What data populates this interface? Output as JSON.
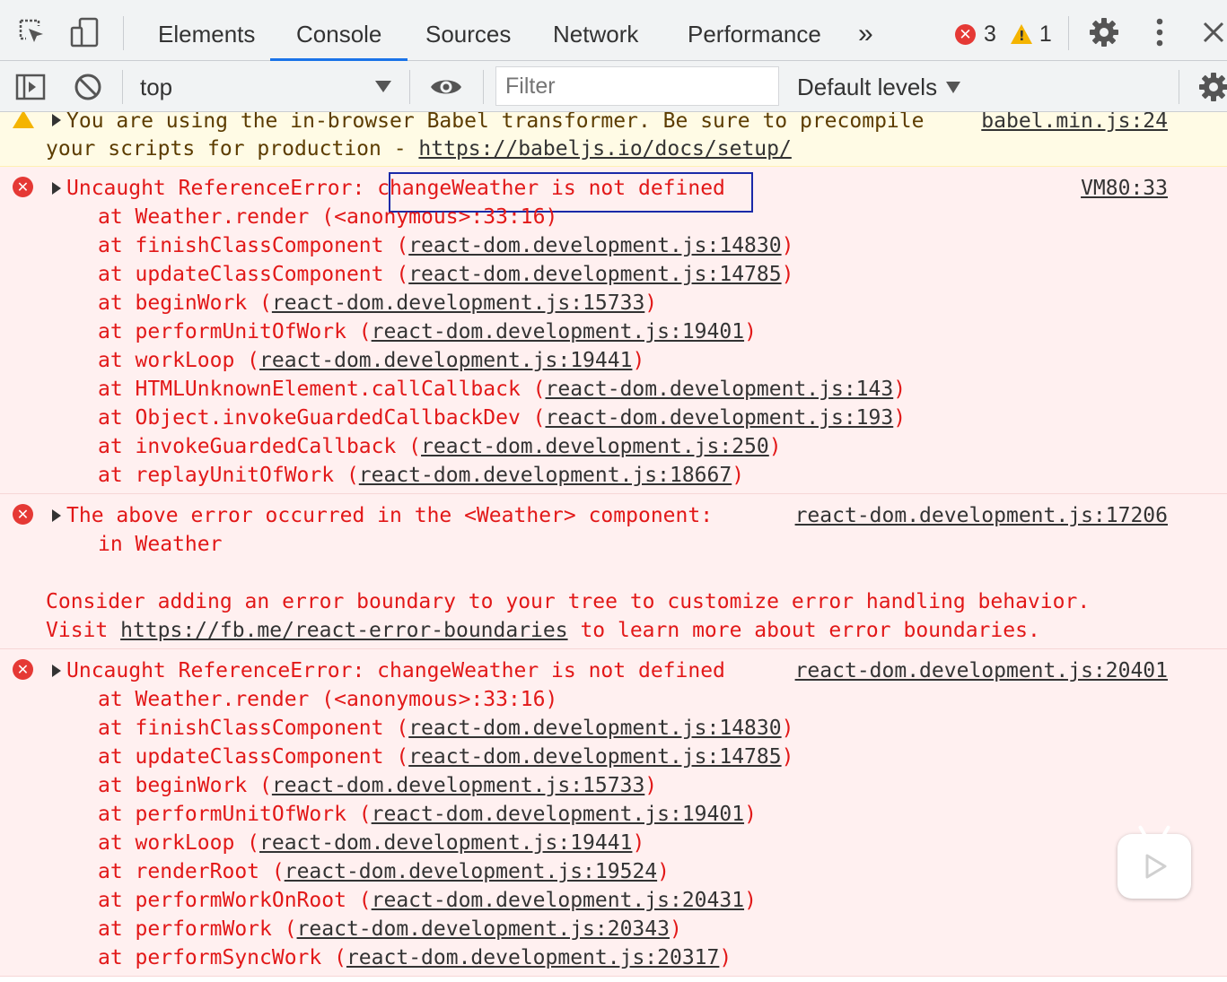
{
  "tabs": [
    {
      "label": "Elements",
      "active": false
    },
    {
      "label": "Console",
      "active": true
    },
    {
      "label": "Sources",
      "active": false
    },
    {
      "label": "Network",
      "active": false
    },
    {
      "label": "Performance",
      "active": false
    }
  ],
  "more_tabs_glyph": "»",
  "counts": {
    "errors": "3",
    "warnings": "1"
  },
  "toolbar": {
    "context": "top",
    "filter_placeholder": "Filter",
    "levels": "Default levels"
  },
  "icons": {
    "inspect": "inspect-element-icon",
    "device": "device-toolbar-icon",
    "settings": "gear-icon",
    "menu": "kebab-menu-icon",
    "close": "close-icon",
    "sidebar": "sidebar-toggle-icon",
    "clear": "clear-console-icon",
    "eye": "live-expression-icon"
  },
  "colors": {
    "accent": "#1a73e8",
    "error_text": "#e21818",
    "error_bg": "#fff0f0",
    "warn_bg": "#fffbe5"
  },
  "messages": {
    "warn": {
      "line1": "You are using the in-browser Babel transformer. Be sure to precompile",
      "line2_prefix": "your scripts for production - ",
      "line2_link": "https://babeljs.io/docs/setup/",
      "source": "babel.min.js:24"
    },
    "error1": {
      "prefix": "Uncaught ReferenceError: ",
      "highlighted": "changeWeather is not defined",
      "source": "VM80:33",
      "stack": [
        {
          "text": "at Weather.render (<anonymous>:33:16)",
          "link": ""
        },
        {
          "text": "at finishClassComponent (",
          "link": "react-dom.development.js:14830",
          "suffix": ")"
        },
        {
          "text": "at updateClassComponent (",
          "link": "react-dom.development.js:14785",
          "suffix": ")"
        },
        {
          "text": "at beginWork (",
          "link": "react-dom.development.js:15733",
          "suffix": ")"
        },
        {
          "text": "at performUnitOfWork (",
          "link": "react-dom.development.js:19401",
          "suffix": ")"
        },
        {
          "text": "at workLoop (",
          "link": "react-dom.development.js:19441",
          "suffix": ")"
        },
        {
          "text": "at HTMLUnknownElement.callCallback (",
          "link": "react-dom.development.js:143",
          "suffix": ")"
        },
        {
          "text": "at Object.invokeGuardedCallbackDev (",
          "link": "react-dom.development.js:193",
          "suffix": ")"
        },
        {
          "text": "at invokeGuardedCallback (",
          "link": "react-dom.development.js:250",
          "suffix": ")"
        },
        {
          "text": "at replayUnitOfWork (",
          "link": "react-dom.development.js:18667",
          "suffix": ")"
        }
      ]
    },
    "error2": {
      "line1": "The above error occurred in the <Weather> component:",
      "source": "react-dom.development.js:17206",
      "line2": "in Weather",
      "line3": "Consider adding an error boundary to your tree to customize error handling behavior.",
      "line4_prefix": "Visit ",
      "line4_link": "https://fb.me/react-error-boundaries",
      "line4_suffix": " to learn more about error boundaries."
    },
    "error3": {
      "line1": "Uncaught ReferenceError: changeWeather is not defined",
      "source": "react-dom.development.js:20401",
      "stack": [
        {
          "text": "at Weather.render (<anonymous>:33:16)",
          "link": ""
        },
        {
          "text": "at finishClassComponent (",
          "link": "react-dom.development.js:14830",
          "suffix": ")"
        },
        {
          "text": "at updateClassComponent (",
          "link": "react-dom.development.js:14785",
          "suffix": ")"
        },
        {
          "text": "at beginWork (",
          "link": "react-dom.development.js:15733",
          "suffix": ")"
        },
        {
          "text": "at performUnitOfWork (",
          "link": "react-dom.development.js:19401",
          "suffix": ")"
        },
        {
          "text": "at workLoop (",
          "link": "react-dom.development.js:19441",
          "suffix": ")"
        },
        {
          "text": "at renderRoot (",
          "link": "react-dom.development.js:19524",
          "suffix": ")"
        },
        {
          "text": "at performWorkOnRoot (",
          "link": "react-dom.development.js:20431",
          "suffix": ")"
        },
        {
          "text": "at performWork (",
          "link": "react-dom.development.js:20343",
          "suffix": ")"
        },
        {
          "text": "at performSyncWork (",
          "link": "react-dom.development.js:20317",
          "suffix": ")"
        }
      ]
    }
  }
}
